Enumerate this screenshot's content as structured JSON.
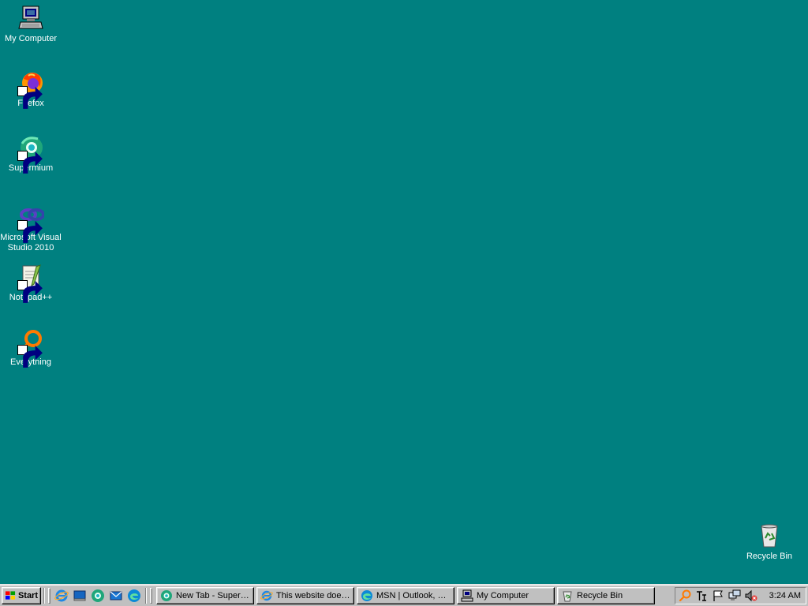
{
  "desktop": {
    "background": "#008080",
    "icons": [
      {
        "label": "My Computer",
        "icon": "computer-icon"
      },
      {
        "label": "Firefox",
        "icon": "firefox-icon"
      },
      {
        "label": "Supermium",
        "icon": "supermium-icon"
      },
      {
        "label": "Microsoft Visual Studio 2010",
        "icon": "visual-studio-icon"
      },
      {
        "label": "Notepad++",
        "icon": "notepad-plus-plus-icon"
      },
      {
        "label": "Everything",
        "icon": "everything-search-icon"
      },
      {
        "label": "Recycle Bin",
        "icon": "recycle-bin-icon"
      }
    ]
  },
  "taskbar": {
    "start_label": "Start",
    "quick_launch": [
      {
        "icon": "internet-explorer-icon"
      },
      {
        "icon": "show-desktop-icon"
      },
      {
        "icon": "supermium-icon"
      },
      {
        "icon": "outlook-express-icon"
      },
      {
        "icon": "edge-icon"
      }
    ],
    "tasks": [
      {
        "label": "New Tab - Superm...",
        "icon": "supermium-icon"
      },
      {
        "label": "This website does...",
        "icon": "internet-explorer-icon"
      },
      {
        "label": "MSN | Outlook, Off...",
        "icon": "edge-icon"
      },
      {
        "label": "My Computer",
        "icon": "computer-icon"
      },
      {
        "label": "Recycle Bin",
        "icon": "recycle-bin-icon"
      }
    ],
    "tray": {
      "icons": [
        "everything-search-icon",
        "ime-icon",
        "flag-icon",
        "network-icon",
        "volume-muted-icon"
      ],
      "clock": "3:24 AM"
    }
  }
}
